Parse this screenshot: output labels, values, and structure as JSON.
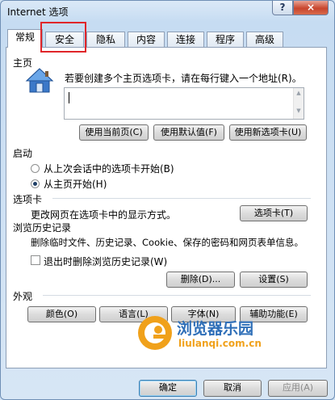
{
  "window": {
    "title": "Internet 选项",
    "help": "?",
    "close": "×"
  },
  "tabs": [
    "常规",
    "安全",
    "隐私",
    "内容",
    "连接",
    "程序",
    "高级"
  ],
  "home": {
    "section": "主页",
    "instruction": "若要创建多个主页选项卡，请在每行键入一个地址(R)。",
    "value": "",
    "btn_current": "使用当前页(C)",
    "btn_default": "使用默认值(F)",
    "btn_new": "使用新选项卡(U)"
  },
  "startup": {
    "section": "启动",
    "option1": "从上次会话中的选项卡开始(B)",
    "option2": "从主页开始(H)",
    "selected": "option2"
  },
  "tabs_section": {
    "section": "选项卡",
    "description": "更改网页在选项卡中的显示方式。",
    "button": "选项卡(T)"
  },
  "history": {
    "section": "浏览历史记录",
    "description": "删除临时文件、历史记录、Cookie、保存的密码和网页表单信息。",
    "checkbox": "退出时删除浏览历史记录(W)",
    "checked": false,
    "btn_delete": "删除(D)...",
    "btn_settings": "设置(S)"
  },
  "appearance": {
    "section": "外观",
    "btn_colors": "颜色(O)",
    "btn_languages": "语言(L)",
    "btn_fonts": "字体(N)",
    "btn_accessibility": "辅助功能(E)"
  },
  "watermark": {
    "cn": "浏览器乐园",
    "url": "liulanqi.com.cn"
  },
  "footer": {
    "ok": "确定",
    "cancel": "取消",
    "apply": "应用(A)"
  }
}
